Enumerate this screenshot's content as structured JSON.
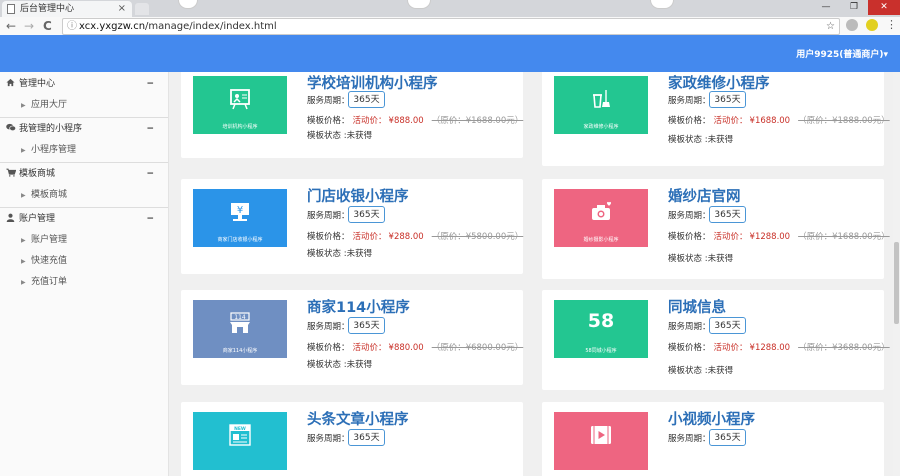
{
  "browser": {
    "tab_title": "后台管理中心",
    "tab_close": "×",
    "url_host": "xcx.yxgzw.cn",
    "url_path": "/manage/index/index.html",
    "back": "←",
    "forward": "→",
    "reload": "C",
    "star": "☆",
    "info": "ⓘ",
    "menu": "⋮",
    "win_min": "—",
    "win_max": "❐",
    "win_close": "✕"
  },
  "header": {
    "user_label": "用户9925(普通商户)",
    "caret": "▾",
    "accent_color": "#4489ee"
  },
  "sidebar": {
    "groups": [
      {
        "label": "管理中心",
        "toggle": "−",
        "icon": "home-icon",
        "items": [
          {
            "label": "应用大厅"
          }
        ]
      },
      {
        "label": "我管理的小程序",
        "toggle": "−",
        "icon": "wechat-icon",
        "items": [
          {
            "label": "小程序管理"
          }
        ]
      },
      {
        "label": "模板商城",
        "toggle": "−",
        "icon": "cart-icon",
        "items": [
          {
            "label": "模板商城"
          }
        ]
      },
      {
        "label": "账户管理",
        "toggle": "−",
        "icon": "user-icon",
        "items": [
          {
            "label": "账户管理"
          },
          {
            "label": "快速充值"
          },
          {
            "label": "充值订单"
          }
        ]
      }
    ],
    "arrow": "▶"
  },
  "labels": {
    "period": "服务周期：",
    "price": "模板价格：",
    "activity": "活动价：",
    "status": "模板状态 :"
  },
  "cards": [
    {
      "title": "学校培训机构小程序",
      "thumb_caption": "培训机构小程序",
      "thumb_color": "#23c691",
      "icon": "training-board-icon",
      "period": "365天",
      "price": "¥888.00",
      "original": "（原价：¥1688.00元）",
      "status": "未获得"
    },
    {
      "title": "家政维修小程序",
      "thumb_caption": "家政维修小程序",
      "thumb_color": "#23c691",
      "icon": "cleaning-icon",
      "period": "365天",
      "price": "¥1688.00",
      "original": "（原价：¥1888.00元）",
      "status": "未获得"
    },
    {
      "title": "门店收银小程序",
      "thumb_caption": "商家门店收银小程序",
      "thumb_color": "#2b94e8",
      "icon": "cashier-icon",
      "period": "365天",
      "price": "¥288.00",
      "original": "（原价：¥5800.00元）",
      "status": "未获得"
    },
    {
      "title": "婚纱店官网",
      "thumb_caption": "婚纱摄影小程序",
      "thumb_color": "#ee6581",
      "icon": "camera-icon",
      "period": "365天",
      "price": "¥1288.00",
      "original": "（原价：¥1688.00元）",
      "status": "未获得"
    },
    {
      "title": "商家114小程序",
      "thumb_caption": "商家114小程序",
      "thumb_color": "#6f8fc2",
      "icon": "store-icon",
      "period": "365天",
      "price": "¥880.00",
      "original": "（原价：¥6800.00元）",
      "status": "未获得"
    },
    {
      "title": "同城信息",
      "thumb_caption": "58同城小程序",
      "thumb_color": "#23c691",
      "icon": "num-58-icon",
      "icon_text": "58",
      "period": "365天",
      "price": "¥1288.00",
      "original": "（原价：¥3688.00元）",
      "status": "未获得"
    },
    {
      "title": "头条文章小程序",
      "thumb_caption": "",
      "thumb_color": "#22bfd0",
      "icon": "newspaper-icon",
      "icon_text": "NEW",
      "period": "365天"
    },
    {
      "title": "小视频小程序",
      "thumb_caption": "",
      "thumb_color": "#ee6581",
      "icon": "video-icon",
      "period": "365天"
    }
  ],
  "store_icon_text": "114",
  "cashier_icon_text": "¥"
}
